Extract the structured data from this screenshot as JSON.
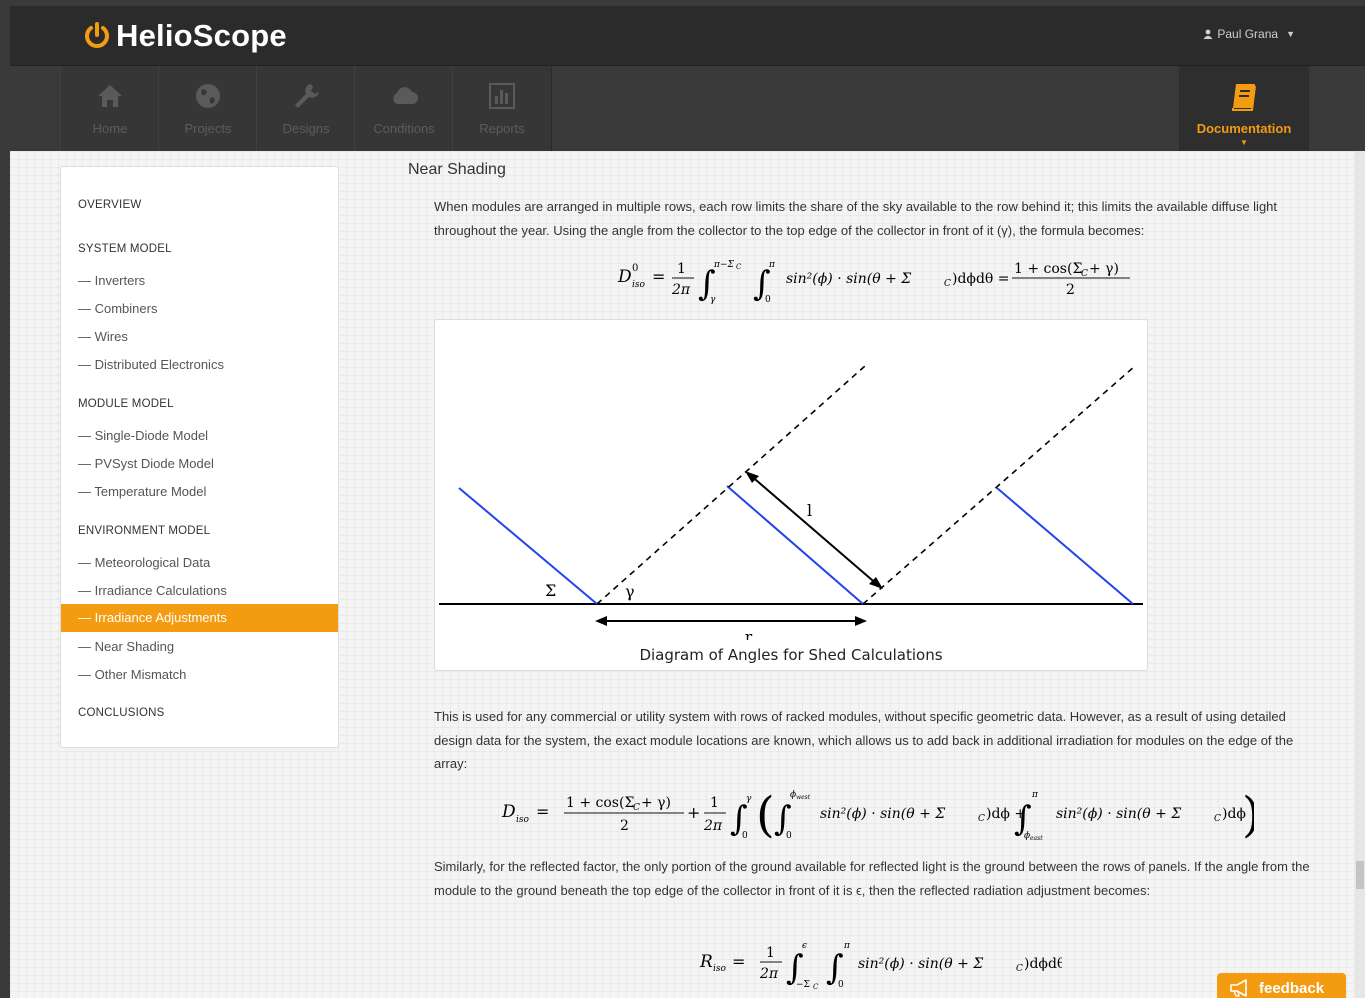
{
  "app": {
    "brand": "HelioScope"
  },
  "user": {
    "name": "Paul Grana"
  },
  "nav": [
    {
      "label": "Home",
      "icon": "home-icon"
    },
    {
      "label": "Projects",
      "icon": "globe-icon"
    },
    {
      "label": "Designs",
      "icon": "wrench-icon"
    },
    {
      "label": "Conditions",
      "icon": "cloud-icon"
    },
    {
      "label": "Reports",
      "icon": "bar-chart-icon"
    }
  ],
  "nav_doc": {
    "label": "Documentation",
    "icon": "book-icon"
  },
  "colors": {
    "accent": "#f39c12",
    "topbar": "#2b2b2b",
    "navbar": "#3a3a3a",
    "diagram_blue": "#2244ee"
  },
  "sidebar": {
    "overview": "OVERVIEW",
    "system_model": "SYSTEM MODEL",
    "system_items": [
      "— Inverters",
      "— Combiners",
      "— Wires",
      "— Distributed Electronics"
    ],
    "module_model": "MODULE MODEL",
    "module_items": [
      "— Single-Diode Model",
      "— PVSyst Diode Model",
      "— Temperature Model"
    ],
    "environment_model": "ENVIRONMENT MODEL",
    "environment_items": [
      "— Meteorological Data",
      "— Irradiance Calculations",
      "— Irradiance Adjustments",
      "— Near Shading",
      "— Other Mismatch"
    ],
    "active_item": "— Irradiance Adjustments",
    "conclusions": "CONCLUSIONS"
  },
  "main": {
    "title": "Near Shading",
    "para1": "When modules are arranged in multiple rows, each row limits the share of the sky available to the row behind it; this limits the available diffuse light throughout the year. Using the angle from the collector to the top edge of the collector in front of it (γ), the formula becomes:",
    "para2": "This is used for any commercial or utility system with rows of racked modules, without specific geometric data. However, as a result of using detailed design data for the system, the exact module locations are known, which allows us to add back in additional irradiation for modules on the edge of the array:",
    "para3": "Similarly, for the reflected factor, the only portion of the ground available for reflected light is the ground between the rows of panels. If the angle from the module to the ground beneath the top edge of the collector in front of it is ϵ, then the reflected radiation adjustment becomes:",
    "figure_caption": "Diagram of Angles for Shed Calculations",
    "diagram_labels": {
      "sigma": "Σ",
      "gamma": "γ",
      "l": "l",
      "r": "r"
    },
    "formula1": {
      "lhs": "D",
      "lhs_sup": "0",
      "lhs_sub": "iso",
      "eq": "=",
      "frac_num": "1",
      "frac_den": "2π",
      "int1_upper": "π−Σ",
      "int1_upper_sub": "C",
      "int1_lower": "γ",
      "int2_upper": "π",
      "int2_lower": "0",
      "integrand": "sin²(ϕ) · sin(θ + Σ",
      "integrand_sub": "C",
      "integrand_end": ")dϕdθ =",
      "rhs_num": "1 + cos(Σ",
      "rhs_num_sub": "C",
      "rhs_num_end": " + γ)",
      "rhs_den": "2"
    },
    "formula2": {
      "lhs": "D",
      "lhs_sub": "iso",
      "eq": "=",
      "f1_num": "1 + cos(Σ",
      "f1_num_sub": "C",
      "f1_num_end": " + γ)",
      "f1_den": "2",
      "plus": "+",
      "f2_num": "1",
      "f2_den": "2π",
      "int_outer_upper": "γ",
      "int_outer_lower": "0",
      "int_a_upper": "ϕ",
      "int_a_upper_sub": "west",
      "int_a_lower": "0",
      "term_a": "sin²(ϕ) · sin(θ + Σ",
      "term_a_sub": "C",
      "term_a_end": ")dϕ +",
      "int_b_upper": "π",
      "int_b_lower": "ϕ",
      "int_b_lower_sub": "east",
      "term_b": "sin²(ϕ) · sin(θ + Σ",
      "term_b_sub": "C",
      "term_b_end": ")dϕ"
    },
    "formula3": {
      "lhs": "R",
      "lhs_sub": "iso",
      "eq": "=",
      "frac_num": "1",
      "frac_den": "2π",
      "int1_upper": "ϵ",
      "int1_lower": "−Σ",
      "int1_lower_sub": "C",
      "int2_upper": "π",
      "int2_lower": "0",
      "integrand": "sin²(ϕ) · sin(θ + Σ",
      "integrand_sub": "C",
      "integrand_end": ")dϕdθ"
    }
  },
  "feedback": {
    "label": "feedback",
    "icon": "megaphone-icon"
  }
}
